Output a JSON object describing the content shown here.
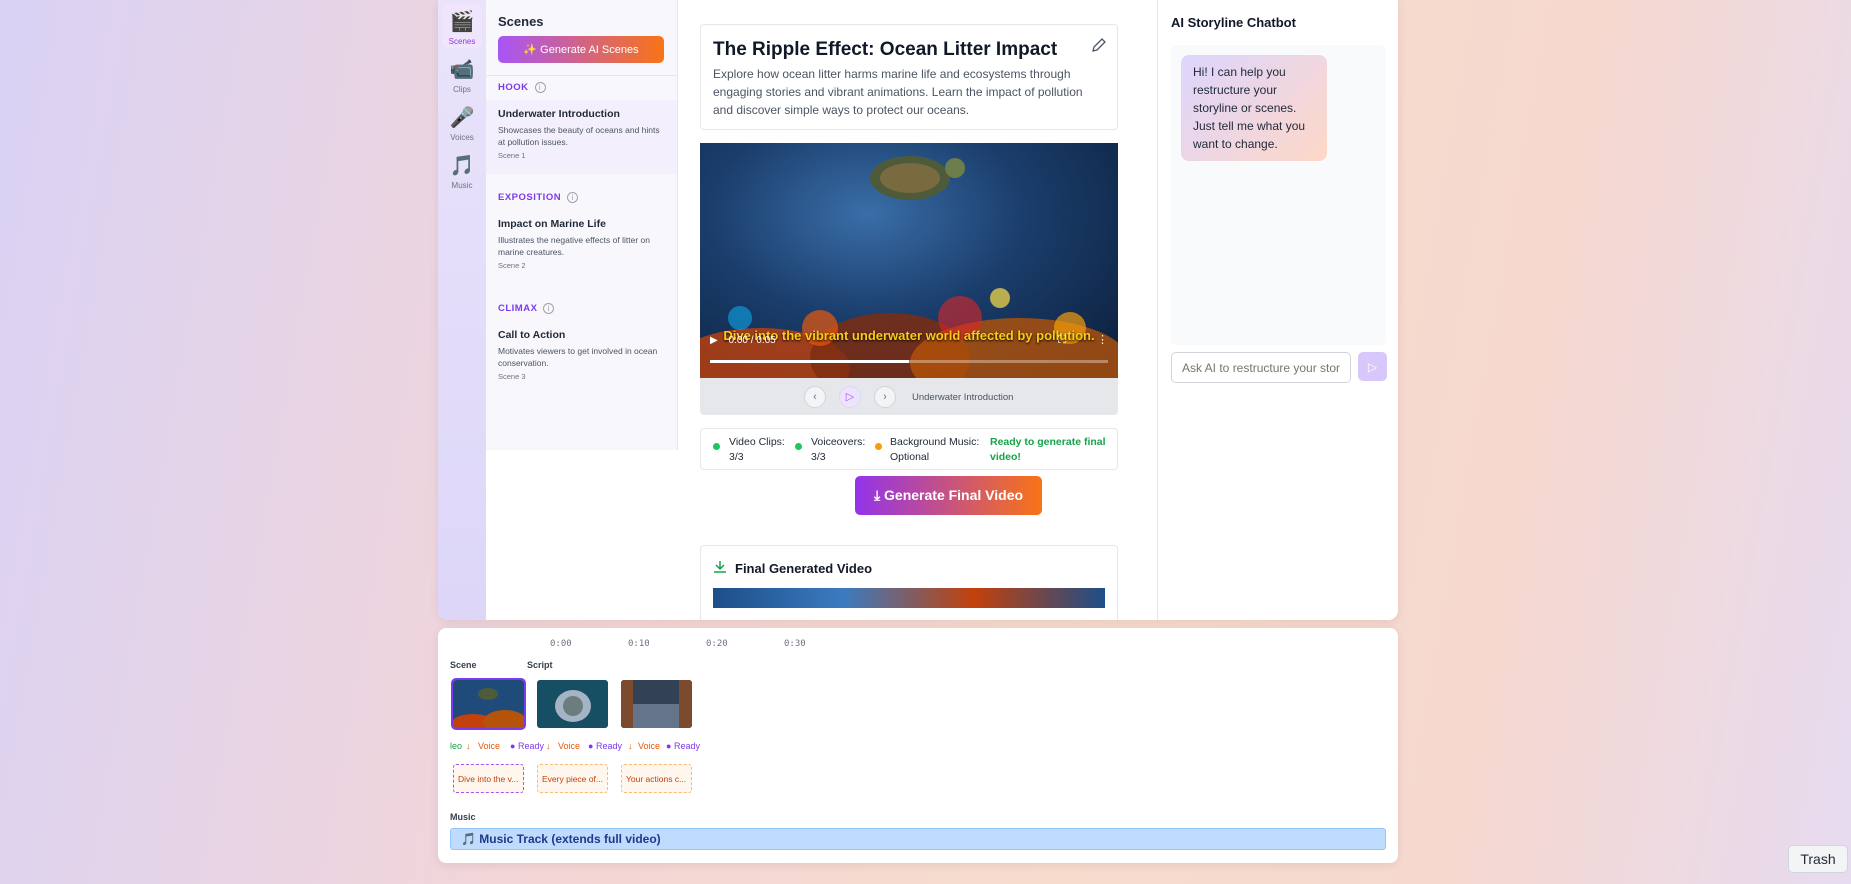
{
  "rail": {
    "items": [
      {
        "label": "Scenes",
        "icon": "clapperboard-icon",
        "glyph": "🎬"
      },
      {
        "label": "Clips",
        "icon": "video-camera-icon",
        "glyph": "📹"
      },
      {
        "label": "Voices",
        "icon": "microphone-icon",
        "glyph": "🎤"
      },
      {
        "label": "Music",
        "icon": "music-note-icon",
        "glyph": "🎵"
      }
    ]
  },
  "scenes": {
    "title": "Scenes",
    "generate_button": "Generate AI Scenes",
    "sections": [
      {
        "label": "HOOK",
        "scene": {
          "name": "Underwater Introduction",
          "desc": "Showcases the beauty of oceans and hints at pollution issues.",
          "num": "Scene 1"
        }
      },
      {
        "label": "EXPOSITION",
        "scene": {
          "name": "Impact on Marine Life",
          "desc": "Illustrates the negative effects of litter on marine creatures.",
          "num": "Scene 2"
        }
      },
      {
        "label": "CLIMAX",
        "scene": {
          "name": "Call to Action",
          "desc": "Motivates viewers to get involved in ocean conservation.",
          "num": "Scene 3"
        }
      }
    ]
  },
  "project": {
    "title": "The Ripple Effect: Ocean Litter Impact",
    "description": "Explore how ocean litter harms marine life and ecosystems through engaging stories and vibrant animations. Learn the impact of pollution and discover simple ways to protect our oceans."
  },
  "video": {
    "subtitle": "Dive into the vibrant underwater world affected by pollution.",
    "time": "0:00 / 0:05",
    "progress": 0.5,
    "current_scene": "Underwater Introduction"
  },
  "status": {
    "video_clips": "Video Clips: 3/3",
    "voiceovers": "Voiceovers: 3/3",
    "music": "Background Music: Optional",
    "ready": "Ready to generate final video!",
    "colors": {
      "ok": "#22c55e",
      "optional": "#f59e0b"
    }
  },
  "final": {
    "button": "Generate Final Video",
    "section_title": "Final Generated Video"
  },
  "chat": {
    "title": "AI Storyline Chatbot",
    "message": "Hi! I can help you restructure your storyline or scenes. Just tell me what you want to change.",
    "placeholder": "Ask AI to restructure your storyline..."
  },
  "timeline": {
    "ticks": [
      "0:00",
      "0:10",
      "0:20",
      "0:30"
    ],
    "scene_label": "Scene",
    "script_label": "Script",
    "music_label": "Music",
    "status_items": [
      "leo",
      "Voice",
      "Ready",
      "Voice",
      "Ready",
      "Voice",
      "Ready"
    ],
    "scripts": [
      "Dive into the v...",
      "Every piece of...",
      "Your actions c..."
    ],
    "music_track": "Music Track (extends full video)"
  },
  "trash": "Trash"
}
